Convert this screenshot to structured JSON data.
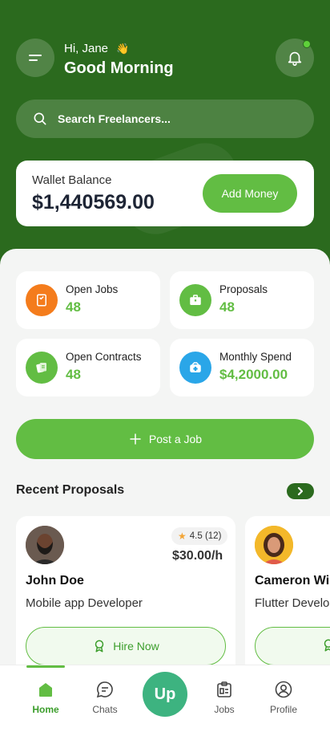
{
  "header": {
    "greeting": "Hi, Jane",
    "greeting_emoji": "👋",
    "title": "Good Morning",
    "menu_icon": "menu-icon",
    "bell_icon": "bell-icon",
    "has_notification": true
  },
  "search": {
    "placeholder": "Search Freelancers..."
  },
  "wallet": {
    "label": "Wallet Balance",
    "amount": "$1,440569.00",
    "add_money_label": "Add Money"
  },
  "stats": [
    {
      "label": "Open Jobs",
      "value": "48",
      "icon": "bookmark-icon",
      "color": "#f47c1c"
    },
    {
      "label": "Proposals",
      "value": "48",
      "icon": "briefcase-icon",
      "color": "#62bd43"
    },
    {
      "label": "Open Contracts",
      "value": "48",
      "icon": "contract-icon",
      "color": "#62bd43"
    },
    {
      "label": "Monthly Spend",
      "value": "$4,2000.00",
      "icon": "wallet-icon",
      "color": "#2aa6e8"
    }
  ],
  "post_job": {
    "label": "Post a Job"
  },
  "recent": {
    "title": "Recent Proposals",
    "cards": [
      {
        "name": "John Doe",
        "role": "Mobile app Developer",
        "rating": "4.5 (12)",
        "rate": "$30.00/h",
        "hire_label": "Hire Now"
      },
      {
        "name": "Cameron Williamson",
        "role": "Flutter Developer",
        "rating": "",
        "rate": "",
        "hire_label": ""
      }
    ]
  },
  "nav": {
    "items": [
      {
        "label": "Home",
        "active": true
      },
      {
        "label": "Chats",
        "active": false
      },
      {
        "label": "Jobs",
        "active": false
      },
      {
        "label": "Profile",
        "active": false
      }
    ],
    "center_label": "Up"
  },
  "colors": {
    "primary_dark": "#2b6a1e",
    "primary": "#62bd43",
    "orange": "#f47c1c",
    "blue": "#2aa6e8"
  }
}
